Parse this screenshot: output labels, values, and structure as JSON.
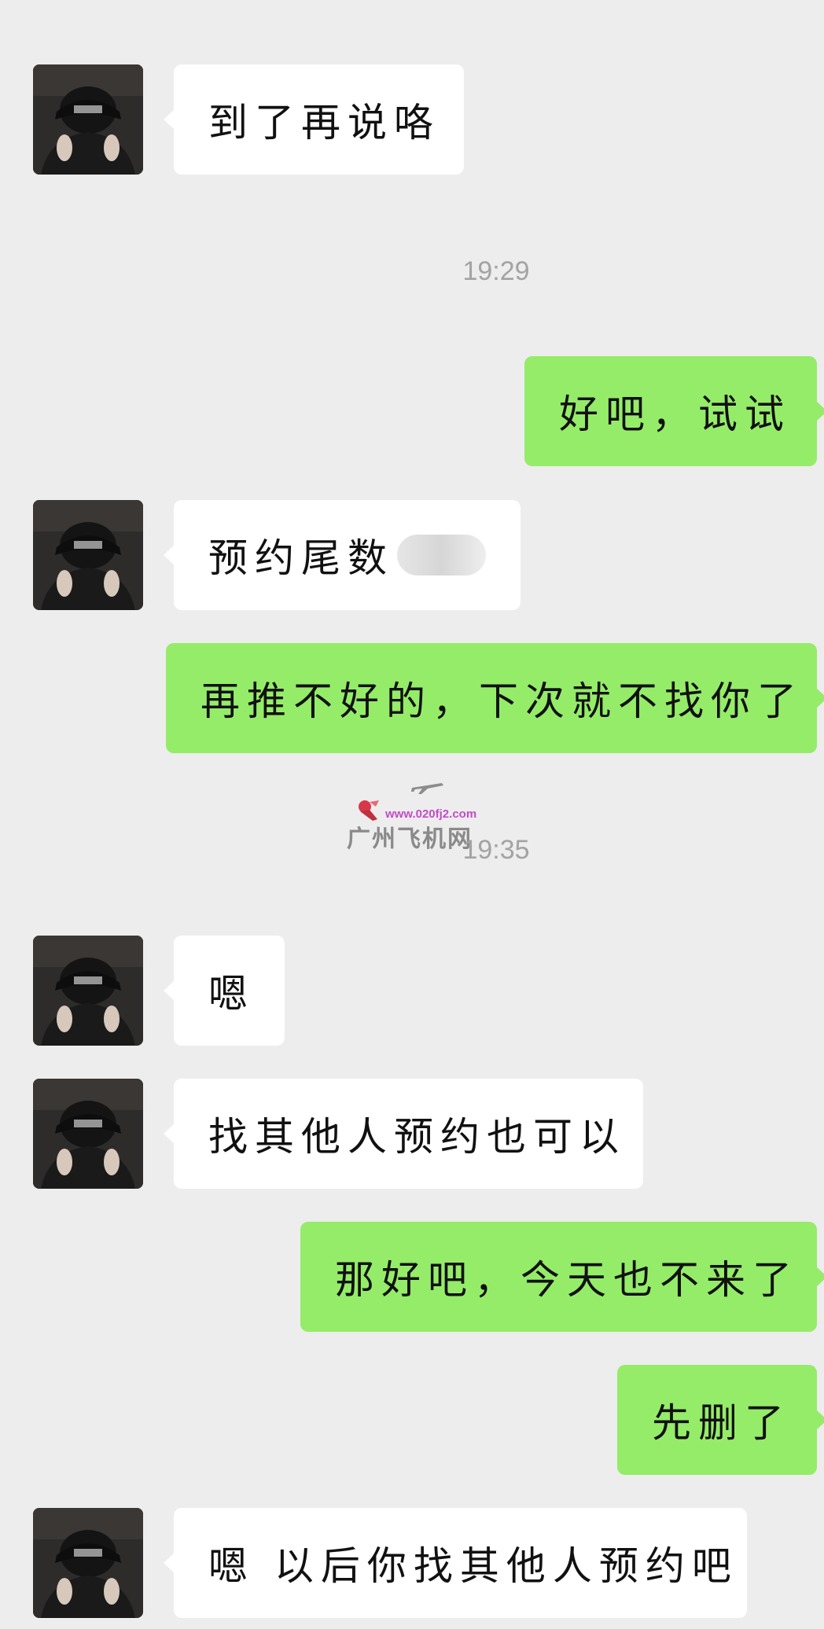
{
  "messages": [
    {
      "side": "in",
      "text": "到了再说咯"
    },
    {
      "time": "19:29"
    },
    {
      "side": "out",
      "text": "好吧，试试"
    },
    {
      "side": "in",
      "text": "预约尾数"
    },
    {
      "side": "out",
      "text": "再推不好的，下次就不找你了"
    },
    {
      "time": "19:35"
    },
    {
      "side": "in",
      "text": "嗯"
    },
    {
      "side": "in",
      "text": "找其他人预约也可以"
    },
    {
      "side": "out",
      "text": "那好吧，今天也不来了"
    },
    {
      "side": "out",
      "text": "先删了"
    },
    {
      "side": "in",
      "text": "嗯 以后你找其他人预约吧"
    }
  ],
  "watermark": {
    "url": "www.020fj2.com",
    "name": "广州飞机网"
  },
  "colors": {
    "background": "#ededed",
    "incoming_bubble": "#ffffff",
    "outgoing_bubble": "#95ec69",
    "timestamp_text": "#a3a3a3"
  }
}
